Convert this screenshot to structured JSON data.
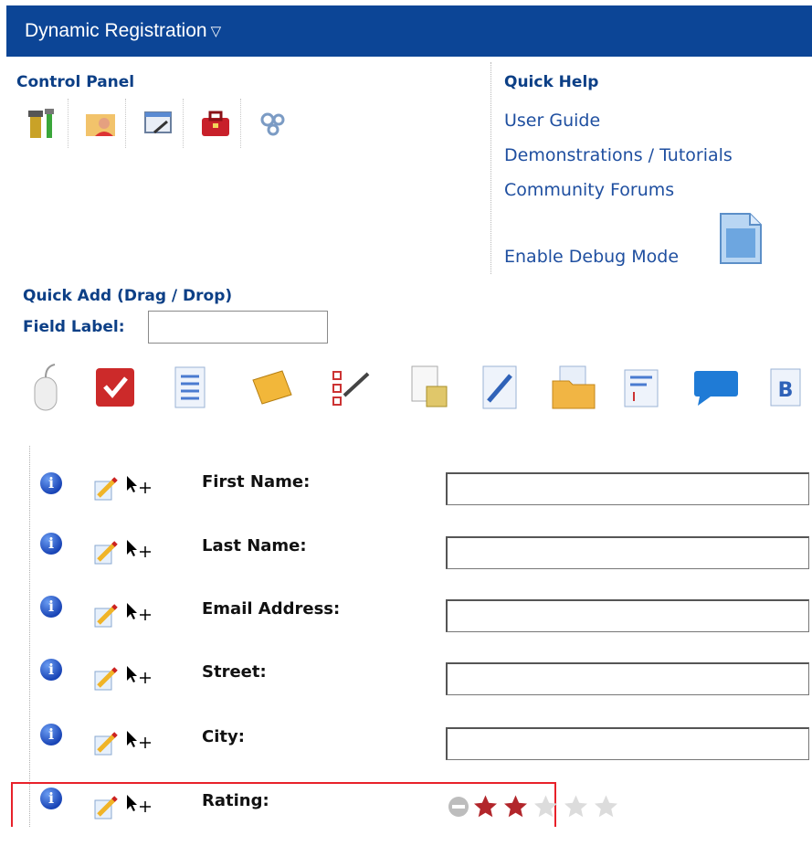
{
  "header": {
    "title": "Dynamic Registration",
    "caret": "▽"
  },
  "control_panel": {
    "title": "Control Panel",
    "icons": [
      "tools-icon",
      "user-folder-icon",
      "edit-window-icon",
      "toolbox-icon",
      "gears-icon"
    ]
  },
  "quick_help": {
    "title": "Quick Help",
    "links": [
      "User Guide",
      "Demonstrations / Tutorials",
      "Community Forums",
      "Enable Debug Mode"
    ],
    "debug_icon": "binary-file-icon"
  },
  "quick_add": {
    "title": "Quick Add (Drag / Drop)",
    "field_label": "Field Label:",
    "field_label_value": "",
    "icons": [
      "mouse-icon",
      "checkbox-icon",
      "list-icon",
      "ticket-icon",
      "checklist-icon",
      "notes-icon",
      "pen-icon",
      "folder-icon",
      "text-page-icon",
      "comment-icon",
      "bold-text-icon"
    ]
  },
  "fields": [
    {
      "label": "First Name:",
      "value": ""
    },
    {
      "label": "Last Name:",
      "value": ""
    },
    {
      "label": "Email Address:",
      "value": ""
    },
    {
      "label": "Street:",
      "value": ""
    },
    {
      "label": "City:",
      "value": ""
    },
    {
      "label": "Rating:",
      "type": "rating"
    }
  ],
  "rating": {
    "value": 2,
    "max": 5
  },
  "colors": {
    "header_bg": "#0c4596",
    "link": "#1f4fa0",
    "highlight": "#e8212a",
    "star_on": "#b2262b",
    "star_off": "#dcdcdc"
  }
}
